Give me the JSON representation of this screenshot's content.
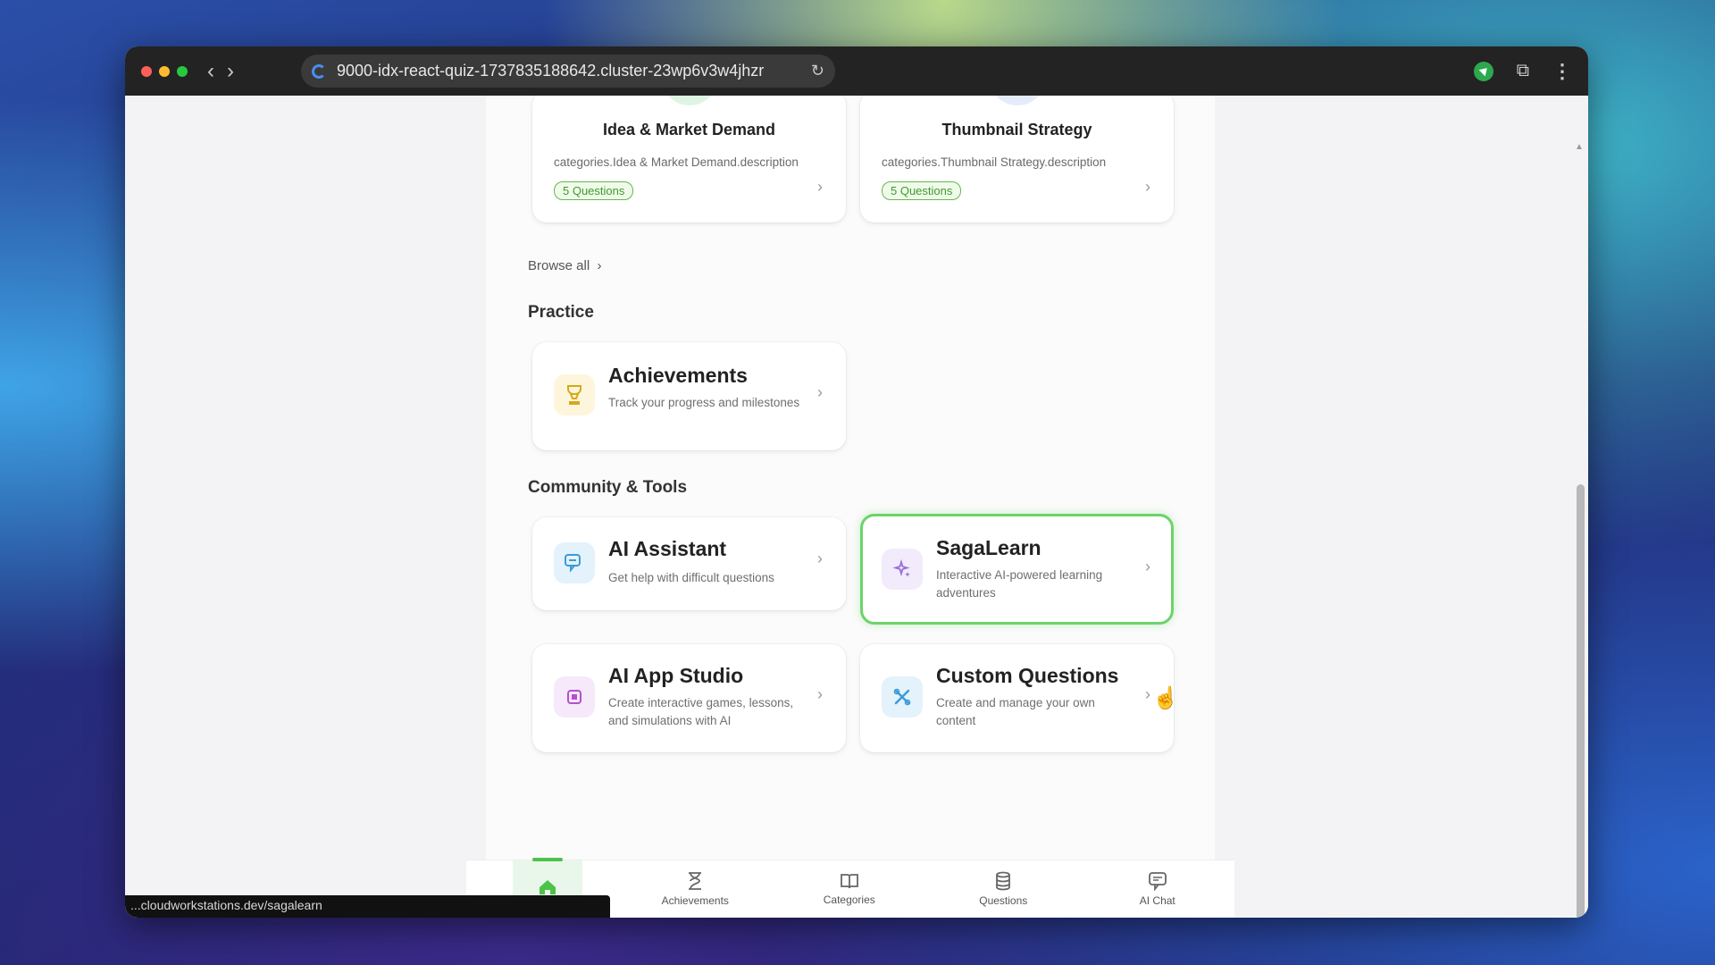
{
  "browser": {
    "url": "9000-idx-react-quiz-1737835188642.cluster-23wp6v3w4jhzr",
    "status_url": "...cloudworkstations.dev/sagalearn"
  },
  "categories": [
    {
      "title": "Idea & Market Demand",
      "description": "categories.Idea & Market Demand.description",
      "badge": "5 Questions",
      "circle_color": "#dff5e4"
    },
    {
      "title": "Thumbnail Strategy",
      "description": "categories.Thumbnail Strategy.description",
      "badge": "5 Questions",
      "circle_color": "#e4ecfb"
    }
  ],
  "browse_all": "Browse all",
  "sections": {
    "practice": "Practice",
    "community": "Community & Tools"
  },
  "tools": {
    "achievements": {
      "title": "Achievements",
      "description": "Track your progress and milestones",
      "icon": "trophy-icon"
    },
    "ai_assistant": {
      "title": "AI Assistant",
      "description": "Get help with difficult questions",
      "icon": "chat-icon"
    },
    "sagalearn": {
      "title": "SagaLearn",
      "description": "Interactive AI-powered learning adventures",
      "icon": "sparkles-icon"
    },
    "ai_app_studio": {
      "title": "AI App Studio",
      "description": "Create interactive games, lessons, and simulations with AI",
      "icon": "chip-icon"
    },
    "custom_questions": {
      "title": "Custom Questions",
      "description": "Create and manage your own content",
      "icon": "tools-icon"
    }
  },
  "bottom_nav": [
    {
      "label": "",
      "icon": "home-icon"
    },
    {
      "label": "Achievements",
      "icon": "trophy-icon"
    },
    {
      "label": "Categories",
      "icon": "book-icon"
    },
    {
      "label": "Questions",
      "icon": "database-icon"
    },
    {
      "label": "AI Chat",
      "icon": "chat-icon"
    }
  ],
  "colors": {
    "accent": "#4cc24a",
    "highlight_border": "#6dd36a"
  }
}
